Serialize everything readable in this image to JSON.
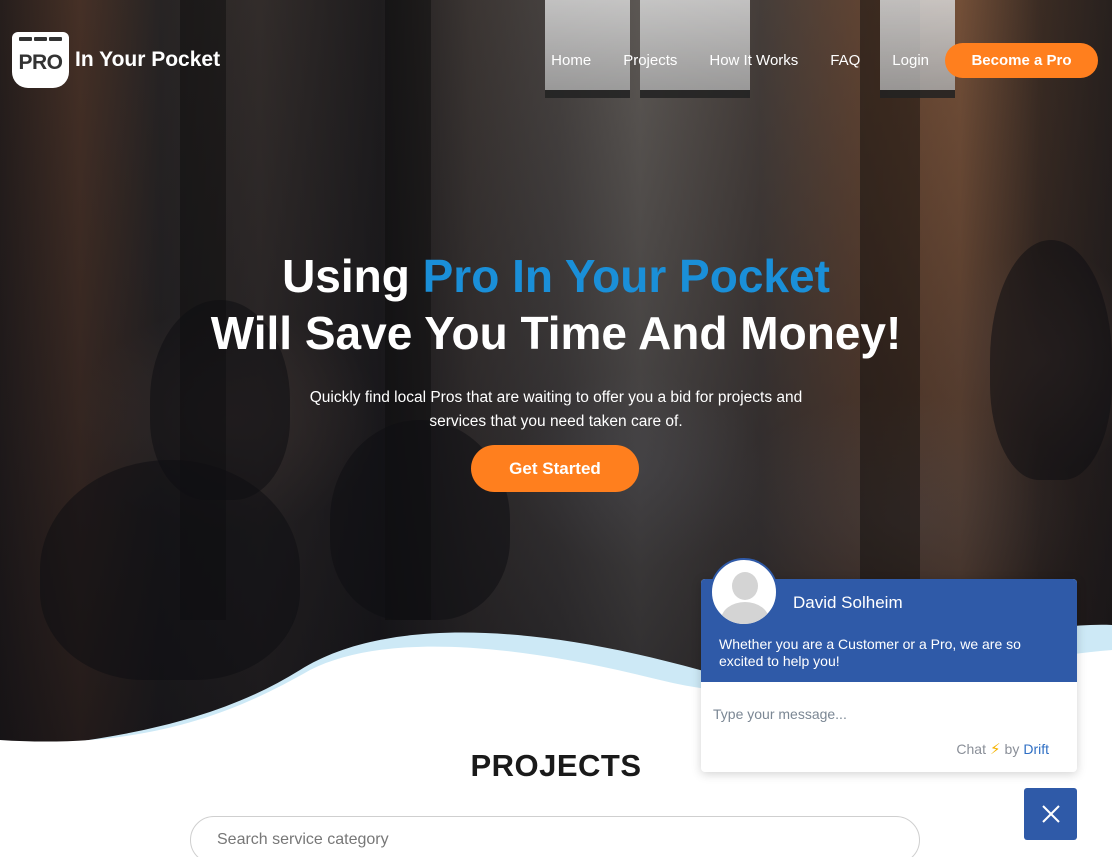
{
  "brand": {
    "badge": "PRO",
    "name": "In Your Pocket"
  },
  "nav": {
    "items": [
      "Home",
      "Projects",
      "How It Works",
      "FAQ",
      "Login"
    ],
    "cta": "Become a Pro"
  },
  "hero": {
    "line1_prefix": "Using ",
    "line1_highlight": "Pro In Your Pocket",
    "line2": "Will Save You Time And Money!",
    "subtitle": "Quickly find local Pros that are waiting to offer you a bid for projects and services that you need taken care of.",
    "cta": "Get Started"
  },
  "projects": {
    "title": "PROJECTS",
    "search_placeholder": "Search service category"
  },
  "chat": {
    "agent": "David Solheim",
    "message": "Whether you are a Customer or a Pro, we are so excited to help you!",
    "input_placeholder": "Type your message...",
    "powered_prefix": "Chat",
    "powered_by": "by",
    "powered_brand": "Drift"
  },
  "colors": {
    "accent_orange": "#ff7f1e",
    "highlight_blue": "#1a8fd8",
    "chat_blue": "#2f5aa8"
  },
  "icons": {
    "chat_close": "close-icon",
    "bolt": "bolt-icon",
    "avatar": "user-avatar-icon"
  }
}
